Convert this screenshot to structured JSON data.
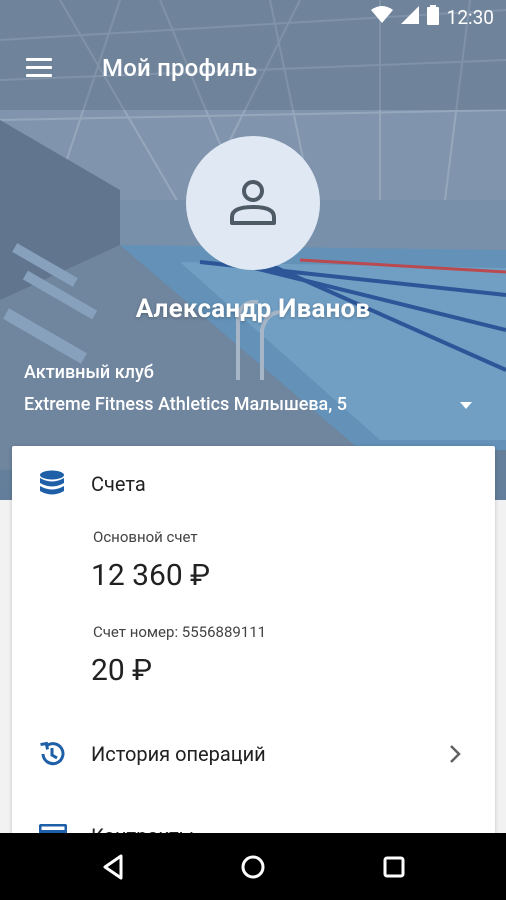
{
  "status_bar": {
    "time": "12:30",
    "icons": [
      "wifi-icon",
      "signal-icon",
      "battery-icon"
    ]
  },
  "toolbar": {
    "title": "Мой профиль",
    "menu_icon": "hamburger-menu-icon"
  },
  "profile": {
    "name": "Александр Иванов",
    "avatar_icon": "user-avatar-icon"
  },
  "club": {
    "label": "Активный клуб",
    "selected": "Extreme Fitness Athletics Малышева, 5"
  },
  "accounts": {
    "title": "Счета",
    "icon": "database-icon",
    "items": [
      {
        "label": "Основной счет",
        "value": "12 360 ₽"
      },
      {
        "label": "Счет номер: 5556889111",
        "value": "20 ₽"
      }
    ]
  },
  "menu": {
    "history": "История операций",
    "contracts": "Контракты"
  },
  "colors": {
    "accent": "#1e5fa8",
    "avatar_bg": "#dfe8f3",
    "nav_bar": "#000000"
  }
}
